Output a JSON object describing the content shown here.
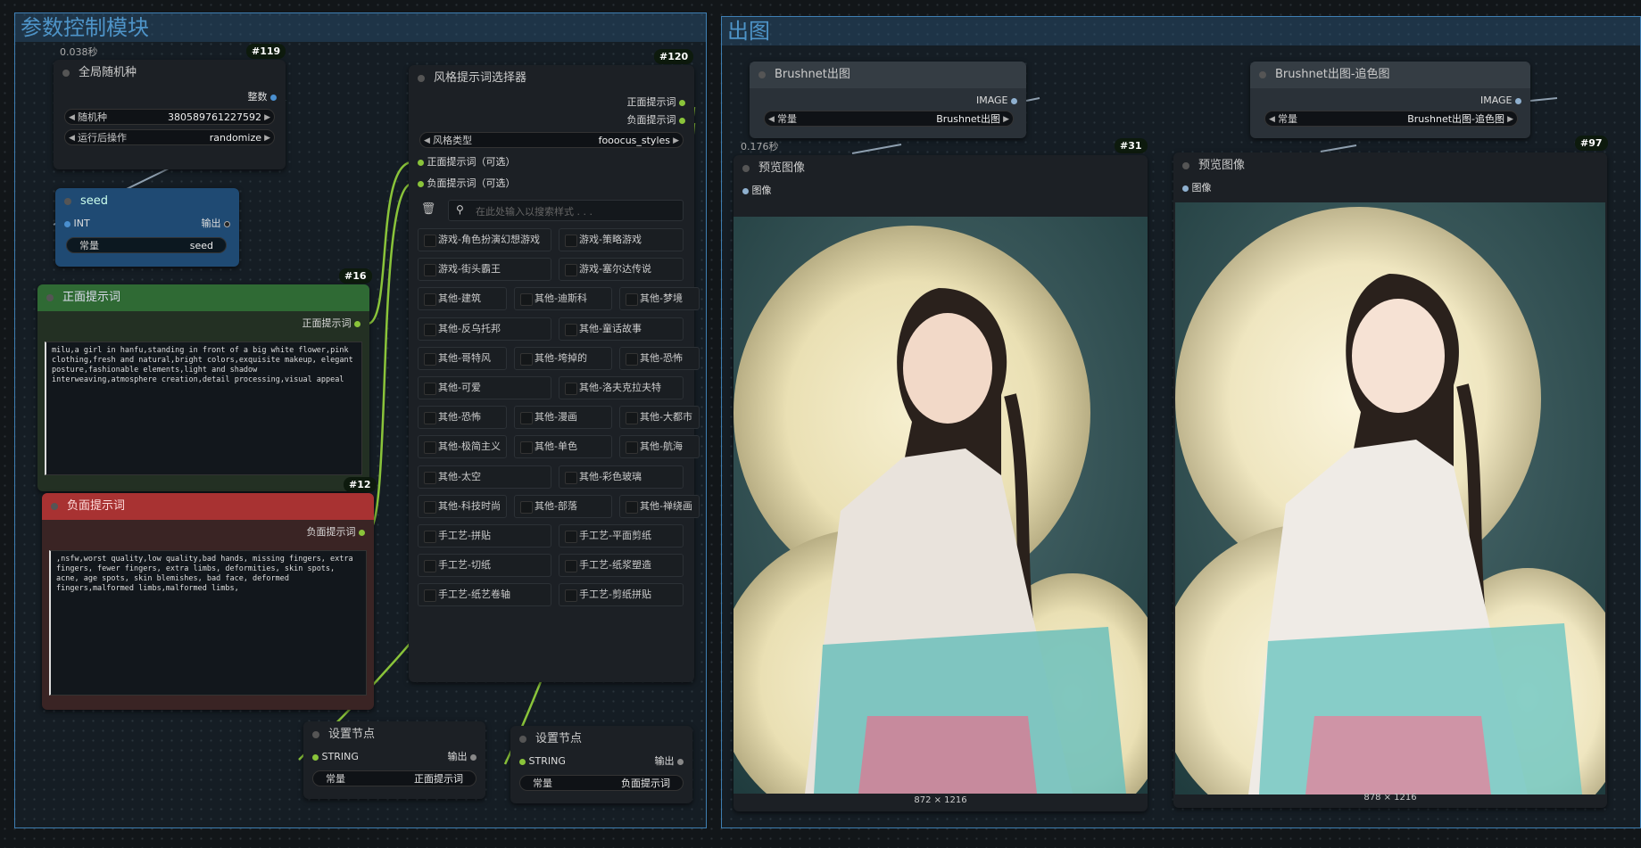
{
  "groups": {
    "left_title": "参数控制模块",
    "right_title": "出图"
  },
  "node119": {
    "badge": "#119",
    "time": "0.038秒",
    "title": "全局随机种",
    "out_label": "整数",
    "seed_label": "随机种",
    "seed_value": "380589761227592",
    "after_label": "运行后操作",
    "after_value": "randomize"
  },
  "seed_node": {
    "title": "seed",
    "in_label": "INT",
    "out_label": "输出",
    "w_label": "常量",
    "w_value": "seed"
  },
  "node16": {
    "badge": "#16",
    "title": "正面提示词",
    "out_label": "正面提示词",
    "text": "milu,a girl in hanfu,standing in front of a big white flower,pink clothing,fresh and natural,bright colors,exquisite makeup, elegant posture,fashionable elements,light and shadow interweaving,atmosphere creation,detail processing,visual appeal"
  },
  "node12": {
    "badge": "#12",
    "title": "负面提示词",
    "out_label": "负面提示词",
    "text": ",nsfw,worst quality,low quality,bad hands, missing fingers, extra fingers, fewer fingers, extra limbs, deformities, skin spots, acne, age spots, skin blemishes, bad face, deformed fingers,malformed limbs,malformed limbs,"
  },
  "node120": {
    "badge": "#120",
    "title": "风格提示词选择器",
    "out1": "正面提示词",
    "out2": "负面提示词",
    "type_label": "风格类型",
    "type_value": "fooocus_styles",
    "in1": "正面提示词（可选）",
    "in2": "负面提示词（可选）",
    "search_placeholder": "在此处输入以搜索样式 . . .",
    "styles": [
      "游戏-角色扮演幻想游戏",
      "游戏-策略游戏",
      "游戏-街头霸王",
      "游戏-塞尔达传说",
      "其他-建筑",
      "其他-迪斯科",
      "其他-梦境",
      "其他-反乌托邦",
      "其他-童话故事",
      "其他-哥特风",
      "其他-垮掉的",
      "其他-恐怖",
      "其他-可爱",
      "其他-洛夫克拉夫特",
      "其他-恐怖",
      "其他-漫画",
      "其他-大都市",
      "其他-极简主义",
      "其他-单色",
      "其他-航海",
      "其他-太空",
      "其他-彩色玻璃",
      "其他-科技时尚",
      "其他-部落",
      "其他-禅绕画",
      "手工艺-拼贴",
      "手工艺-平面剪纸",
      "手工艺-切纸",
      "手工艺-纸浆塑造",
      "手工艺-纸艺卷轴",
      "手工艺-剪纸拼贴"
    ]
  },
  "setnode1": {
    "title": "设置节点",
    "in_label": "STRING",
    "out_label": "输出",
    "w_label": "常量",
    "w_value": "正面提示词"
  },
  "setnode2": {
    "title": "设置节点",
    "in_label": "STRING",
    "out_label": "输出",
    "w_label": "常量",
    "w_value": "负面提示词"
  },
  "brushnet1": {
    "title": "Brushnet出图",
    "out_label": "IMAGE",
    "w_label": "常量",
    "w_value": "Brushnet出图"
  },
  "brushnet2": {
    "title": "Brushnet出图-追色图",
    "out_label": "IMAGE",
    "w_label": "常量",
    "w_value": "Brushnet出图-追色图"
  },
  "preview31": {
    "badge": "#31",
    "time": "0.176秒",
    "title": "预览图像",
    "in_label": "图像",
    "dims": "872 × 1216"
  },
  "preview97": {
    "badge": "#97",
    "title": "预览图像",
    "in_label": "图像",
    "dims": "878 × 1216"
  },
  "colors": {
    "group_border": "#3f7fb3",
    "green_header": "#2f6a34",
    "red_header": "#a83232",
    "blue_node": "#1f4a73",
    "wire": "#8ac43a"
  }
}
